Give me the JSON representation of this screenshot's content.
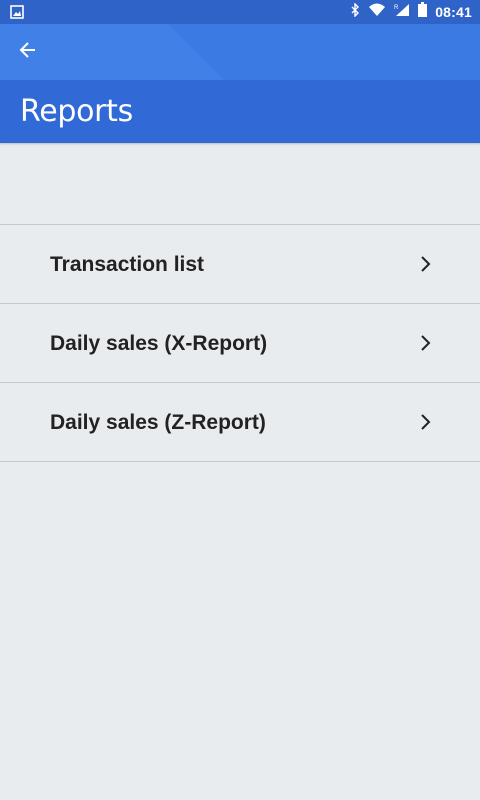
{
  "status_bar": {
    "time": "08:41",
    "icons": [
      "image-icon",
      "bluetooth-icon",
      "wifi-icon",
      "signal-icon",
      "battery-icon"
    ]
  },
  "app_bar": {
    "back_icon": "back-arrow-icon"
  },
  "header": {
    "title": "Reports"
  },
  "menu": {
    "items": [
      {
        "label": "Transaction list",
        "icon": "chevron-right-icon"
      },
      {
        "label": "Daily sales (X-Report)",
        "icon": "chevron-right-icon"
      },
      {
        "label": "Daily sales (Z-Report)",
        "icon": "chevron-right-icon"
      }
    ]
  },
  "colors": {
    "status_bar": "#2f63c8",
    "app_bar": "#3b7ae2",
    "title_bar": "#3169d7",
    "background": "#e8ecef",
    "divider": "#c5c9cd",
    "text": "#222222"
  }
}
